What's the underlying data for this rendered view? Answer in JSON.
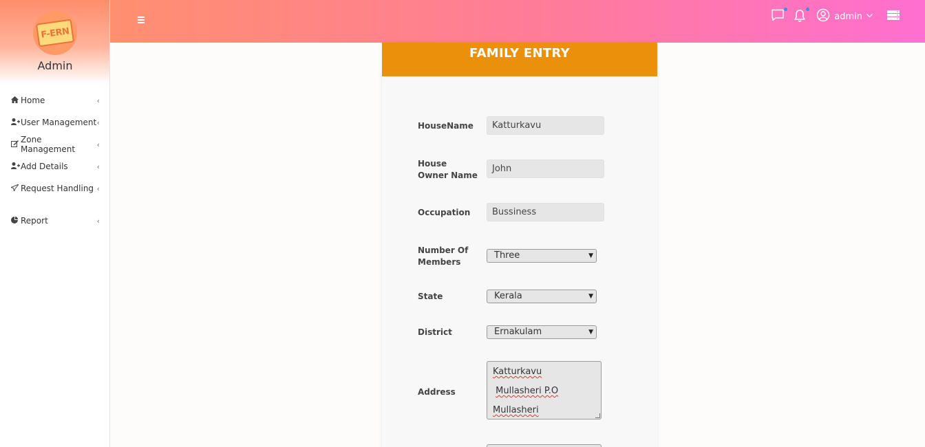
{
  "sidebar": {
    "logo_text": "F-ERN",
    "title": "Admin",
    "items": [
      {
        "label": "Home",
        "icon": "home-icon"
      },
      {
        "label": "User Management",
        "icon": "user-plus-icon"
      },
      {
        "label": "Zone Management",
        "icon": "edit-icon"
      },
      {
        "label": "Add Details",
        "icon": "user-plus-icon"
      },
      {
        "label": "Request Handling",
        "icon": "paper-plane-icon"
      },
      {
        "label": "Report",
        "icon": "pie-chart-icon"
      }
    ]
  },
  "topbar": {
    "username": "admin",
    "icons": [
      "menu-icon",
      "chat-icon",
      "bell-icon",
      "user-circle-icon",
      "stack-icon"
    ],
    "notification_color": "#3a8fe8"
  },
  "form": {
    "title": "FAMILY ENTRY",
    "house_name_label": "HouseName",
    "house_name_value": "Katturkavu",
    "owner_label": "House Owner Name",
    "owner_value": "John",
    "occupation_label": "Occupation",
    "occupation_value": "Bussiness",
    "members_label": "Number Of Members",
    "members_value": "Three",
    "state_label": "State",
    "state_value": "Kerala",
    "district_label": "District",
    "district_value": "Ernakulam",
    "address_label": "Address",
    "address_lines": [
      "Katturkavu",
      "Mullasheri P.O",
      "Mullasheri"
    ]
  },
  "colors": {
    "card_header": "#ea900a",
    "topbar_start": "#ff8f6f",
    "topbar_end": "#ff6fd0"
  }
}
